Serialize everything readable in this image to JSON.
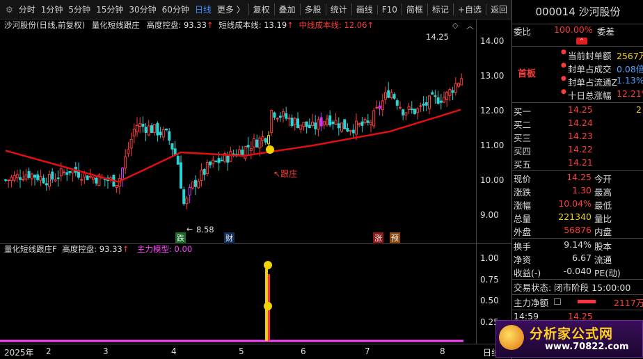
{
  "toolbar": {
    "items": [
      "分时",
      "1分钟",
      "5分钟",
      "15分钟",
      "30分钟",
      "60分钟",
      "日线",
      "更多 〉"
    ],
    "active_index": 6,
    "right_items": [
      "复权",
      "叠加",
      "多股",
      "统计",
      "画线",
      "F10",
      "简框",
      "标记",
      "+自选",
      "返回"
    ]
  },
  "main_chart": {
    "title": "沙河股份(日线,前复权)",
    "indicator_name": "量化短线跟庄",
    "height_label": "高度控盘: 93.33",
    "short_cost": "短线成本线: 13.19",
    "mid_cost": "中线成本线: 12.06",
    "high_label": "14.25",
    "low_label": "8.58",
    "annotation": "跟庄",
    "markers": [
      "跌",
      "财",
      "涨",
      "预"
    ],
    "y_ticks": [
      "14.00",
      "13.00",
      "12.00",
      "11.00",
      "10.00",
      "9.00"
    ]
  },
  "sub_chart": {
    "title": "量化短线跟庄F",
    "height_label": "高度控盘: 93.33",
    "main_model": "主力模型: 0.00",
    "y_ticks": [
      "1.00",
      "0.75",
      "0.50",
      "0.25"
    ]
  },
  "date_axis": {
    "labels": [
      "2025年",
      "2",
      "3",
      "4",
      "5",
      "6",
      "7",
      "8"
    ],
    "right_label": "日线"
  },
  "panel": {
    "code_name": "000014 沙河股份",
    "weibi_label": "委比",
    "weibi_value": "100.00%",
    "weicha_label": "委差",
    "first_board": "首板",
    "stats": [
      {
        "label": "当前封单额",
        "value": "2567万"
      },
      {
        "label": "封单占成交",
        "value": "0.08倍"
      },
      {
        "label": "封单占流通Z",
        "value": "1.13%"
      },
      {
        "label": "十日总涨幅",
        "value": "12.21%"
      }
    ],
    "bids": [
      {
        "label": "买一",
        "price": "14.25",
        "vol": "2"
      },
      {
        "label": "买二",
        "price": "14.24",
        "vol": ""
      },
      {
        "label": "买三",
        "price": "14.23",
        "vol": ""
      },
      {
        "label": "买四",
        "price": "14.22",
        "vol": ""
      },
      {
        "label": "买五",
        "price": "14.21",
        "vol": ""
      }
    ],
    "quote": [
      {
        "l1": "现价",
        "v1": "14.25",
        "l2": "今开",
        "v2": ""
      },
      {
        "l1": "涨跌",
        "v1": "1.30",
        "l2": "最高",
        "v2": ""
      },
      {
        "l1": "涨幅",
        "v1": "10.04%",
        "l2": "最低",
        "v2": ""
      },
      {
        "l1": "总量",
        "v1": "221340",
        "l2": "量比",
        "v2": ""
      },
      {
        "l1": "外盘",
        "v1": "56876",
        "l2": "内盘",
        "v2": ""
      }
    ],
    "quote2": [
      {
        "l1": "换手",
        "v1": "9.14%",
        "l2": "股本"
      },
      {
        "l1": "净资",
        "v1": "6.67",
        "l2": "流通"
      },
      {
        "l1": "收益(-)",
        "v1": "-0.040",
        "l2": "PE(动)"
      }
    ],
    "trade_status": "交易状态: 闭市阶段 15:00:00",
    "main_net_label": "主力净额",
    "main_net_value": "2117万",
    "tick_time": "14:59",
    "tick_price": "14.25",
    "watermark_title": "分析家公式网",
    "watermark_url": "www.70822.com"
  },
  "colors": {
    "up": "#ff3b3b",
    "down": "#25d4d4",
    "ma": "#e01010",
    "accent": "#3d8bff",
    "mag": "#ff44ff"
  }
}
